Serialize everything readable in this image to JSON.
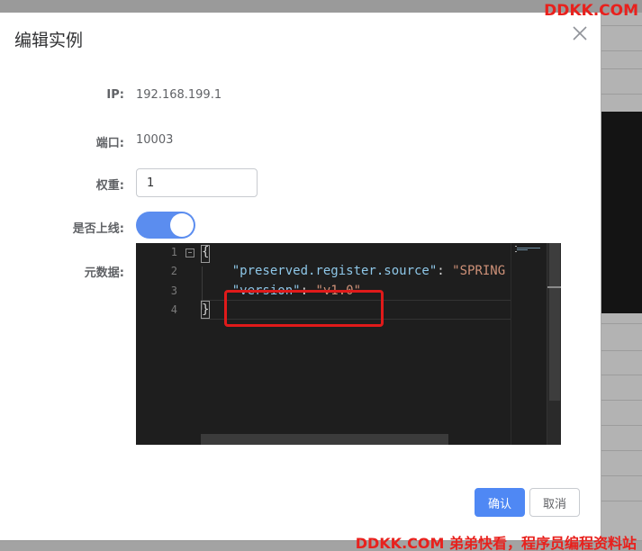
{
  "dialog": {
    "title": "编辑实例",
    "close_icon": "close-icon"
  },
  "form": {
    "ip_label": "IP:",
    "ip_value": "192.168.199.1",
    "port_label": "端口:",
    "port_value": "10003",
    "weight_label": "权重:",
    "weight_value": "1",
    "online_label": "是否上线:",
    "online_enabled": true,
    "metadata_label": "元数据:"
  },
  "editor": {
    "line_numbers": [
      "1",
      "2",
      "3",
      "4"
    ],
    "line1": "{",
    "line2_key": "\"preserved.register.source\"",
    "line2_sep": ": ",
    "line2_val": "\"SPRING",
    "line3_key": "\"version\"",
    "line3_sep": ": ",
    "line3_val": "\"v1.0\"",
    "line4": "}"
  },
  "footer": {
    "confirm_label": "确认",
    "cancel_label": "取消"
  },
  "watermark": {
    "top": "DDKK.COM",
    "bottom": "DDKK.COM 弟弟快看，程序员编程资料站"
  },
  "colors": {
    "primary": "#4f88f4",
    "switch_on": "#5b8def",
    "highlight": "#e01a1a",
    "watermark": "#e8211d"
  }
}
